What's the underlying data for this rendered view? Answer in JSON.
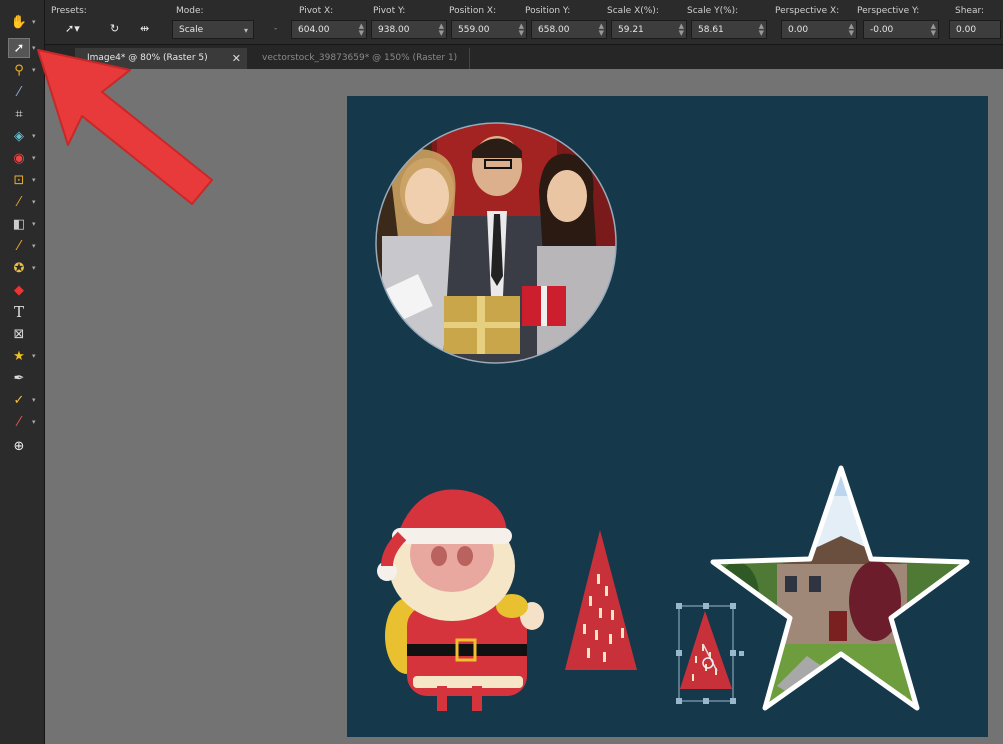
{
  "optbar": {
    "presets_label": "Presets:",
    "mode_label": "Mode:",
    "mode_value": "Scale",
    "dash": "-",
    "fields": [
      {
        "label": "Pivot X:",
        "value": "604.00"
      },
      {
        "label": "Pivot Y:",
        "value": "938.00"
      },
      {
        "label": "Position X:",
        "value": "559.00"
      },
      {
        "label": "Position Y:",
        "value": "658.00"
      },
      {
        "label": "Scale X(%):",
        "value": "59.21"
      },
      {
        "label": "Scale Y(%):",
        "value": "58.61"
      },
      {
        "label": "Perspective X:",
        "value": "0.00"
      },
      {
        "label": "Perspective Y:",
        "value": "-0.00"
      },
      {
        "label": "Shear:",
        "value": "0.00"
      }
    ]
  },
  "tabs": [
    {
      "label": "Image4* @ 80% (Raster 5)",
      "close": "✕"
    },
    {
      "label": "vectorstock_39873659* @ 150% (Raster 1)"
    }
  ],
  "tools": [
    "pan-icon",
    "pick-icon",
    "lasso-icon",
    "dropper-icon",
    "crop-icon",
    "straighten-icon",
    "red-eye-icon",
    "makeover-icon",
    "brush-icon",
    "gradient-icon",
    "retouch-icon",
    "color-replace-icon",
    "fill-icon",
    "text-icon",
    "shape-icon",
    "star-shape-icon",
    "pen-icon",
    "draw-icon",
    "eraser-icon",
    "add-icon"
  ],
  "colors": {
    "canvas": "#15384b",
    "workspace": "#737373",
    "arrow": "#e83a3a",
    "santa_red": "#d6343c",
    "tree_red": "#c8303a"
  }
}
